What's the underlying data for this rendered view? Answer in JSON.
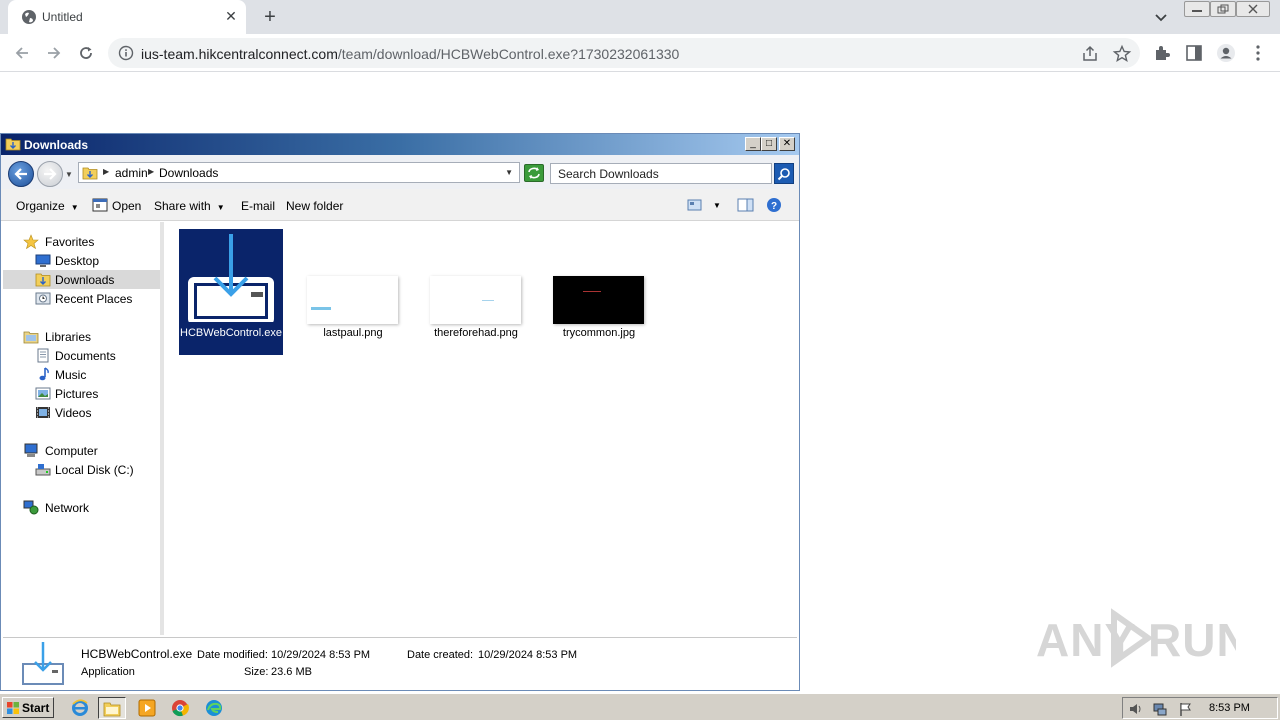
{
  "browser": {
    "tab_title": "Untitled",
    "url_host": "ius-team.hikcentralconnect.com",
    "url_path": "/team/download/HCBWebControl.exe?1730232061330"
  },
  "explorer": {
    "title": "Downloads",
    "breadcrumb": [
      "admin",
      "Downloads"
    ],
    "search_placeholder": "Search Downloads",
    "commands": {
      "organize": "Organize",
      "open": "Open",
      "share_with": "Share with",
      "email": "E-mail",
      "new_folder": "New folder"
    },
    "nav": {
      "favorites": "Favorites",
      "desktop": "Desktop",
      "downloads": "Downloads",
      "recent_places": "Recent Places",
      "libraries": "Libraries",
      "documents": "Documents",
      "music": "Music",
      "pictures": "Pictures",
      "videos": "Videos",
      "computer": "Computer",
      "local_disk": "Local Disk (C:)",
      "network": "Network"
    },
    "files": [
      {
        "name": "HCBWebControl.exe",
        "selected": true
      },
      {
        "name": "lastpaul.png",
        "selected": false
      },
      {
        "name": "thereforehad.png",
        "selected": false
      },
      {
        "name": "trycommon.jpg",
        "selected": false
      }
    ],
    "status": {
      "name": "HCBWebControl.exe",
      "type": "Application",
      "modified_label": "Date modified:",
      "modified_value": "10/29/2024 8:53 PM",
      "created_label": "Date created:",
      "created_value": "10/29/2024 8:53 PM",
      "size_label": "Size:",
      "size_value": "23.6 MB"
    }
  },
  "watermark": "ANY RUN",
  "taskbar": {
    "start": "Start",
    "clock": "8:53 PM"
  },
  "colors": {
    "selection": "#0a246a",
    "titlebar": "#0a246a",
    "chrome_frame": "#dee1e6"
  }
}
